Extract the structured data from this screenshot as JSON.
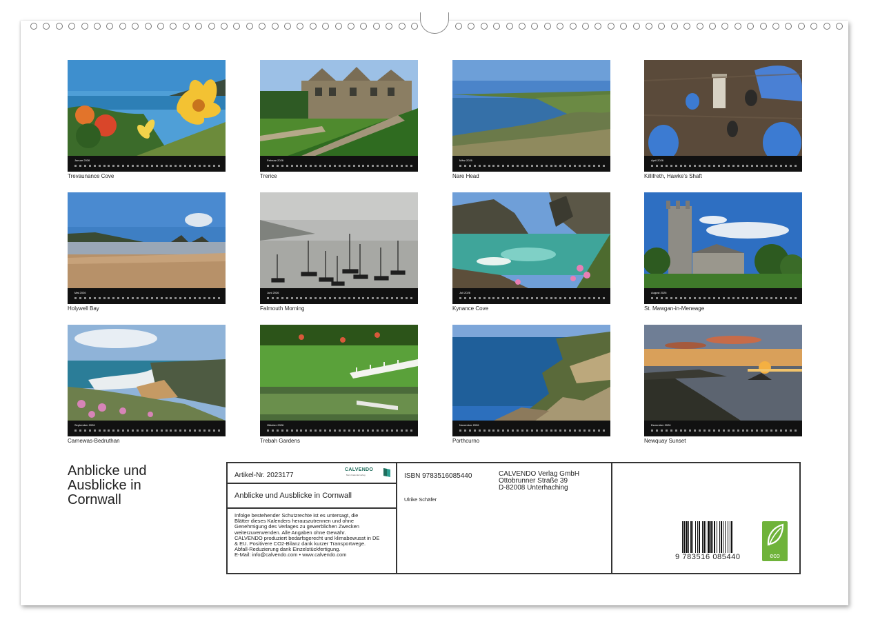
{
  "calendar_months": [
    {
      "month": "Januar 2026",
      "caption": "Trevaunance Cove"
    },
    {
      "month": "Februar 2026",
      "caption": "Trerice"
    },
    {
      "month": "März 2026",
      "caption": "Nare Head"
    },
    {
      "month": "April 2026",
      "caption": "Killifreth, Hawke's Shaft"
    },
    {
      "month": "Mai 2026",
      "caption": "Holywell Bay"
    },
    {
      "month": "Juni 2026",
      "caption": "Falmouth Morning"
    },
    {
      "month": "Juli 2026",
      "caption": "Kynance Cove"
    },
    {
      "month": "August 2026",
      "caption": "St. Mawgan-in-Meneage"
    },
    {
      "month": "September 2026",
      "caption": "Carnewas-Bedruthan"
    },
    {
      "month": "Oktober 2026",
      "caption": "Trebah Gardens"
    },
    {
      "month": "November 2026",
      "caption": "Porthcurno"
    },
    {
      "month": "Dezember 2026",
      "caption": "Newquay Sunset"
    }
  ],
  "cover_title": {
    "line1": "Anblicke und",
    "line2": "Ausblicke in",
    "line3": "Cornwall"
  },
  "info": {
    "article_number": "Artikel-Nr. 2023177",
    "brand_name": "CALVENDO",
    "brand_sub": "Mein Kalenderverlag",
    "title": "Anblicke und Ausblicke in Cornwall",
    "legal_lines": [
      "Infolge bestehender Schutzrechte ist es untersagt, die",
      "Blätter dieses Kalenders herauszutrennen und ohne",
      "Genehmigung des Verlages zu gewerblichen Zwecken",
      "weiterzuverwenden. Alle Angaben ohne Gewähr.",
      "CALVENDO produziert bedarfsgerecht und klimabewusst in DE",
      "& EU. Positivere CO2-Bilanz dank kurzer Transportwege.",
      "Abfall-Reduzierung dank Einzelstückfertigung.",
      "E-Mail: info@calvendo.com • www.calvendo.com"
    ],
    "isbn": "ISBN 9783516085440",
    "author": "Ulrike Schäfer",
    "publisher_lines": [
      "CALVENDO Verlag GmbH",
      "Ottobrunner Straße 39",
      "D-82008 Unterhaching"
    ],
    "ean": "9 783516 085440",
    "eco_label": "eco"
  }
}
